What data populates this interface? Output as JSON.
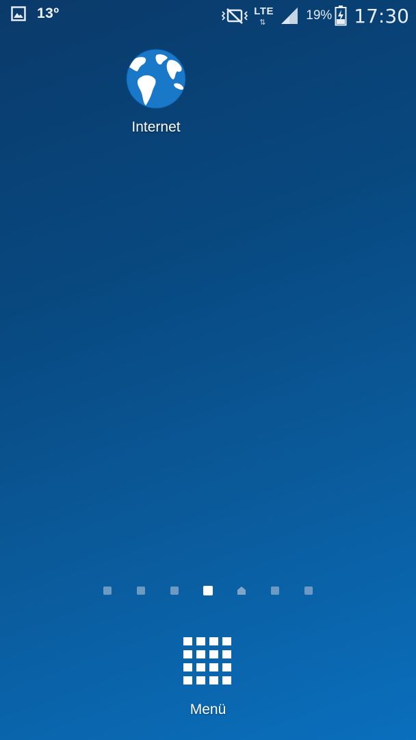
{
  "status_bar": {
    "notification_icon": "gallery-icon",
    "temperature": "13º",
    "sound_icon": "vibrate-mute-icon",
    "network_type": "LTE",
    "network_arrows": "⇅",
    "signal_icon": "signal-icon",
    "battery_percent": "19%",
    "battery_icon": "battery-charging-icon",
    "time": "17:30"
  },
  "home_screen": {
    "apps": [
      {
        "label": "Internet",
        "icon": "globe-icon"
      }
    ]
  },
  "page_indicator": {
    "total_pages": 7,
    "active_page": 4,
    "home_page": 5
  },
  "dock": {
    "menu_label": "Menü",
    "menu_icon": "apps-grid-icon"
  },
  "colors": {
    "background_top": "#0a3a6a",
    "background_bottom": "#0a6fbd",
    "globe_blue": "#1a78c8",
    "dot_inactive": "#7fa5c9",
    "dot_active": "#ffffff"
  }
}
